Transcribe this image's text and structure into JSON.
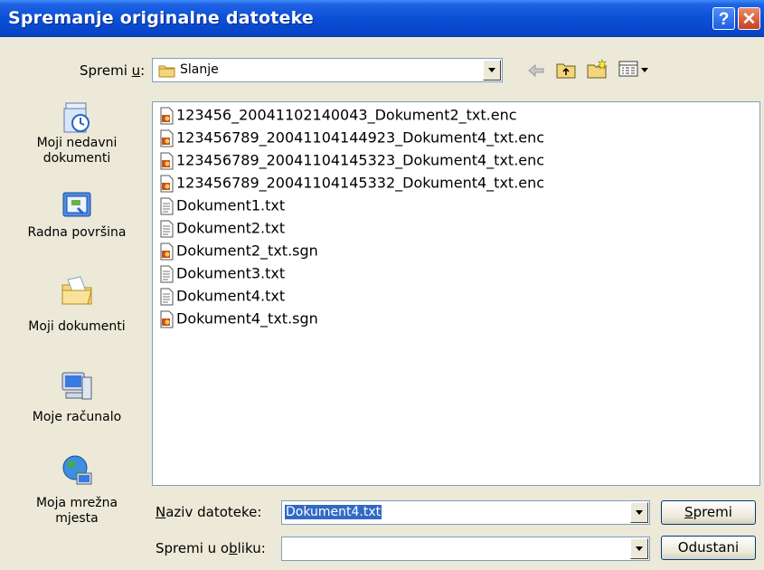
{
  "window": {
    "title": "Spremanje originalne datoteke"
  },
  "titlebar_buttons": {
    "help": "?",
    "close": "✕"
  },
  "save_in": {
    "label_prefix": "Spremi ",
    "label_accel": "u",
    "label_suffix": ":",
    "value": "Slanje"
  },
  "places": [
    {
      "label_line1": "Moji nedavni",
      "label_line2": "dokumenti",
      "icon": "recent-documents-icon"
    },
    {
      "label_line1": "Radna površina",
      "label_line2": "",
      "icon": "desktop-icon"
    },
    {
      "label_line1": "Moji dokumenti",
      "label_line2": "",
      "icon": "my-documents-icon"
    },
    {
      "label_line1": "Moje računalo",
      "label_line2": "",
      "icon": "my-computer-icon"
    },
    {
      "label_line1": "Moja mrežna",
      "label_line2": "mjesta",
      "icon": "network-places-icon"
    }
  ],
  "files": [
    {
      "name": "123456_20041102140043_Dokument2_txt.enc",
      "icon": "certificate-file-icon"
    },
    {
      "name": "123456789_20041104144923_Dokument4_txt.enc",
      "icon": "certificate-file-icon"
    },
    {
      "name": "123456789_20041104145323_Dokument4_txt.enc",
      "icon": "certificate-file-icon"
    },
    {
      "name": "123456789_20041104145332_Dokument4_txt.enc",
      "icon": "certificate-file-icon"
    },
    {
      "name": "Dokument1.txt",
      "icon": "text-file-icon"
    },
    {
      "name": "Dokument2.txt",
      "icon": "text-file-icon"
    },
    {
      "name": "Dokument2_txt.sgn",
      "icon": "certificate-file-icon"
    },
    {
      "name": "Dokument3.txt",
      "icon": "text-file-icon"
    },
    {
      "name": "Dokument4.txt",
      "icon": "text-file-icon"
    },
    {
      "name": "Dokument4_txt.sgn",
      "icon": "certificate-file-icon"
    }
  ],
  "filename": {
    "label_accel": "N",
    "label_rest": "aziv datoteke:",
    "value": "Dokument4.txt"
  },
  "filetype": {
    "label_prefix": "Spremi u o",
    "label_accel": "b",
    "label_suffix": "liku:",
    "value": ""
  },
  "buttons": {
    "save_accel": "S",
    "save_rest": "premi",
    "cancel": "Odustani"
  }
}
